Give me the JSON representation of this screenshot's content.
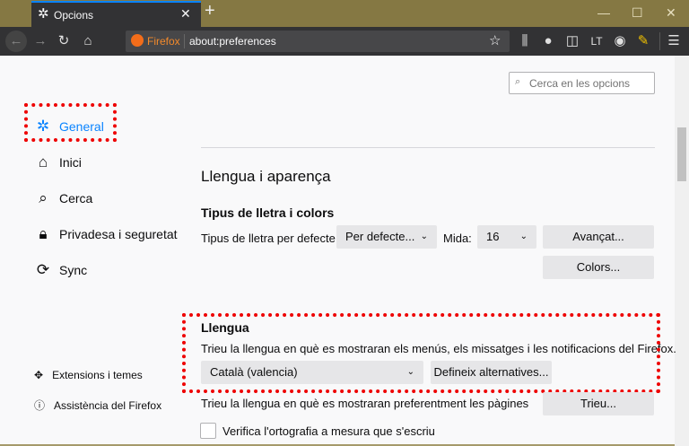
{
  "window": {
    "tab_title": "Opcions",
    "new_tab": "+",
    "minimize": "—",
    "maximize": "☐",
    "close": "✕"
  },
  "toolbar": {
    "identity": "Firefox",
    "url": "about:preferences"
  },
  "search": {
    "placeholder": "Cerca en les opcions"
  },
  "sidebar": {
    "items": [
      {
        "label": "General",
        "icon": "gear-icon",
        "active": true
      },
      {
        "label": "Inici",
        "icon": "home-icon"
      },
      {
        "label": "Cerca",
        "icon": "search-icon"
      },
      {
        "label": "Privadesa i seguretat",
        "icon": "lock-icon"
      },
      {
        "label": "Sync",
        "icon": "sync-icon"
      }
    ],
    "footer": [
      {
        "label": "Extensions i temes",
        "icon": "puzzle-icon"
      },
      {
        "label": "Assistència del Firefox",
        "icon": "help-icon"
      }
    ]
  },
  "main": {
    "section_title": "Llengua i aparença",
    "fonts": {
      "title": "Tipus de lletra i colors",
      "default_label": "Tipus de lletra per defecte",
      "default_value": "Per defecte...",
      "size_label": "Mida:",
      "size_value": "16",
      "advanced": "Avançat...",
      "colors": "Colors..."
    },
    "language": {
      "title": "Llengua",
      "description": "Trieu la llengua en què es mostraran els menús, els missatges i les notificacions del Firefox.",
      "value": "Català (valencia)",
      "alternatives": "Defineix alternatives...",
      "pages_label": "Trieu la llengua en què es mostraran preferentment les pàgines",
      "choose": "Trieu...",
      "spellcheck": "Verifica l'ortografia a mesura que s'escriu",
      "spellcheck_checked": false
    }
  },
  "colors": {
    "accent": "#0a84ff",
    "annotation": "#e00000",
    "titlebar": "#857843"
  }
}
